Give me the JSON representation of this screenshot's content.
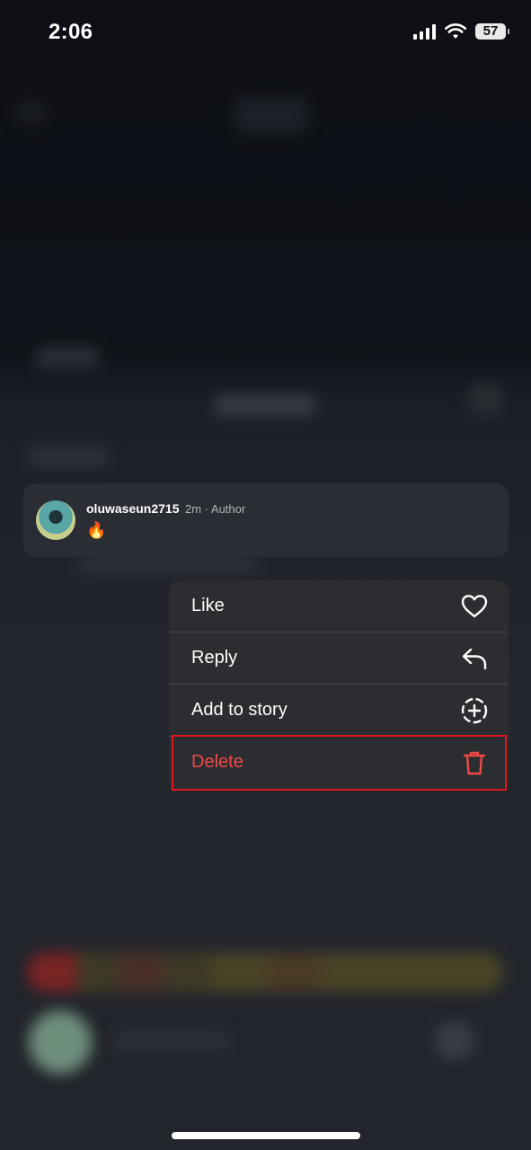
{
  "status_bar": {
    "time": "2:06",
    "battery": "57"
  },
  "comment": {
    "username": "oluwaseun2715",
    "meta": "2m · Author",
    "text": "🔥"
  },
  "context_menu": {
    "items": [
      {
        "label": "Like",
        "icon": "heart-icon"
      },
      {
        "label": "Reply",
        "icon": "reply-arrow-icon"
      },
      {
        "label": "Add to story",
        "icon": "add-to-story-icon"
      },
      {
        "label": "Delete",
        "icon": "trash-icon"
      }
    ],
    "delete_color": "#ee4b47",
    "highlight_color": "#e4141d"
  }
}
